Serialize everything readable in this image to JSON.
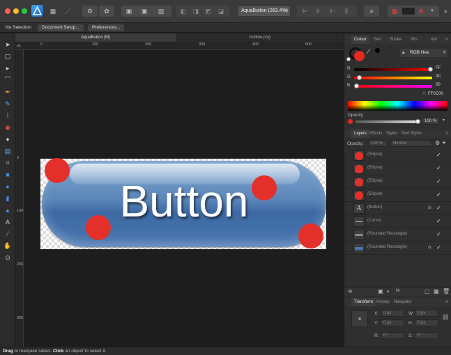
{
  "toolbar": {
    "document_zoom": "AquaButton (263.4%)"
  },
  "context_bar": {
    "selection_label": "No Selection",
    "doc_setup_label": "Document Setup...",
    "preferences_label": "Preferences..."
  },
  "tabs": [
    {
      "label": "AquaButton [M]"
    },
    {
      "label": "bubble.png"
    }
  ],
  "rulers": {
    "unit": "px",
    "h_ticks": [
      "0",
      "100",
      "200",
      "300",
      "400",
      "500"
    ],
    "v_ticks": [
      "0",
      "100",
      "200",
      "300"
    ]
  },
  "canvas": {
    "button_text": "Button"
  },
  "status": {
    "drag_word": "Drag",
    "drag_text": " to marquee select. ",
    "click_word": "Click",
    "click_text": " an object to select it."
  },
  "colour_panel": {
    "tabs": [
      "Colour",
      "Swt",
      "Stroke",
      "Brs",
      "Apr"
    ],
    "mode": "RGB Hex",
    "r_label": "R",
    "r_value": "FF",
    "g_label": "G",
    "g_value": "0C",
    "b_label": "B",
    "b_value": "00",
    "hex_value": "FF0C00",
    "opacity_label": "Opacity",
    "opacity_value": "100 %",
    "accent_color": "#ff0c00"
  },
  "layers_panel": {
    "tabs": [
      "Layers",
      "Effects",
      "Styles",
      "Text Styles"
    ],
    "opacity_label": "Opacity:",
    "opacity_value": "100 %",
    "blend_mode": "Normal",
    "layers": [
      {
        "name": "(Ellipse)",
        "thumb": "ellipse",
        "fx": ""
      },
      {
        "name": "(Ellipse)",
        "thumb": "ellipse",
        "fx": ""
      },
      {
        "name": "(Ellipse)",
        "thumb": "ellipse",
        "fx": ""
      },
      {
        "name": "(Ellipse)",
        "thumb": "ellipse",
        "fx": ""
      },
      {
        "name": "(Button)",
        "thumb": "text",
        "fx": "fx"
      },
      {
        "name": "(Curve)",
        "thumb": "curve",
        "fx": ""
      },
      {
        "name": "(Rounded Rectangle)",
        "thumb": "rrect",
        "fx": ""
      },
      {
        "name": "(Rounded Rectangle)",
        "thumb": "rrect-blue",
        "fx": "fx"
      }
    ]
  },
  "transform_panel": {
    "tabs": [
      "Transform",
      "History",
      "Navigator"
    ],
    "x_label": "X:",
    "x_value": "0 px",
    "y_label": "Y:",
    "y_value": "0 px",
    "w_label": "W:",
    "w_value": "0 px",
    "h_label": "H:",
    "h_value": "0 px",
    "r_label": "R:",
    "r_value": "0 °",
    "s_label": "S:",
    "s_value": "0 °"
  }
}
